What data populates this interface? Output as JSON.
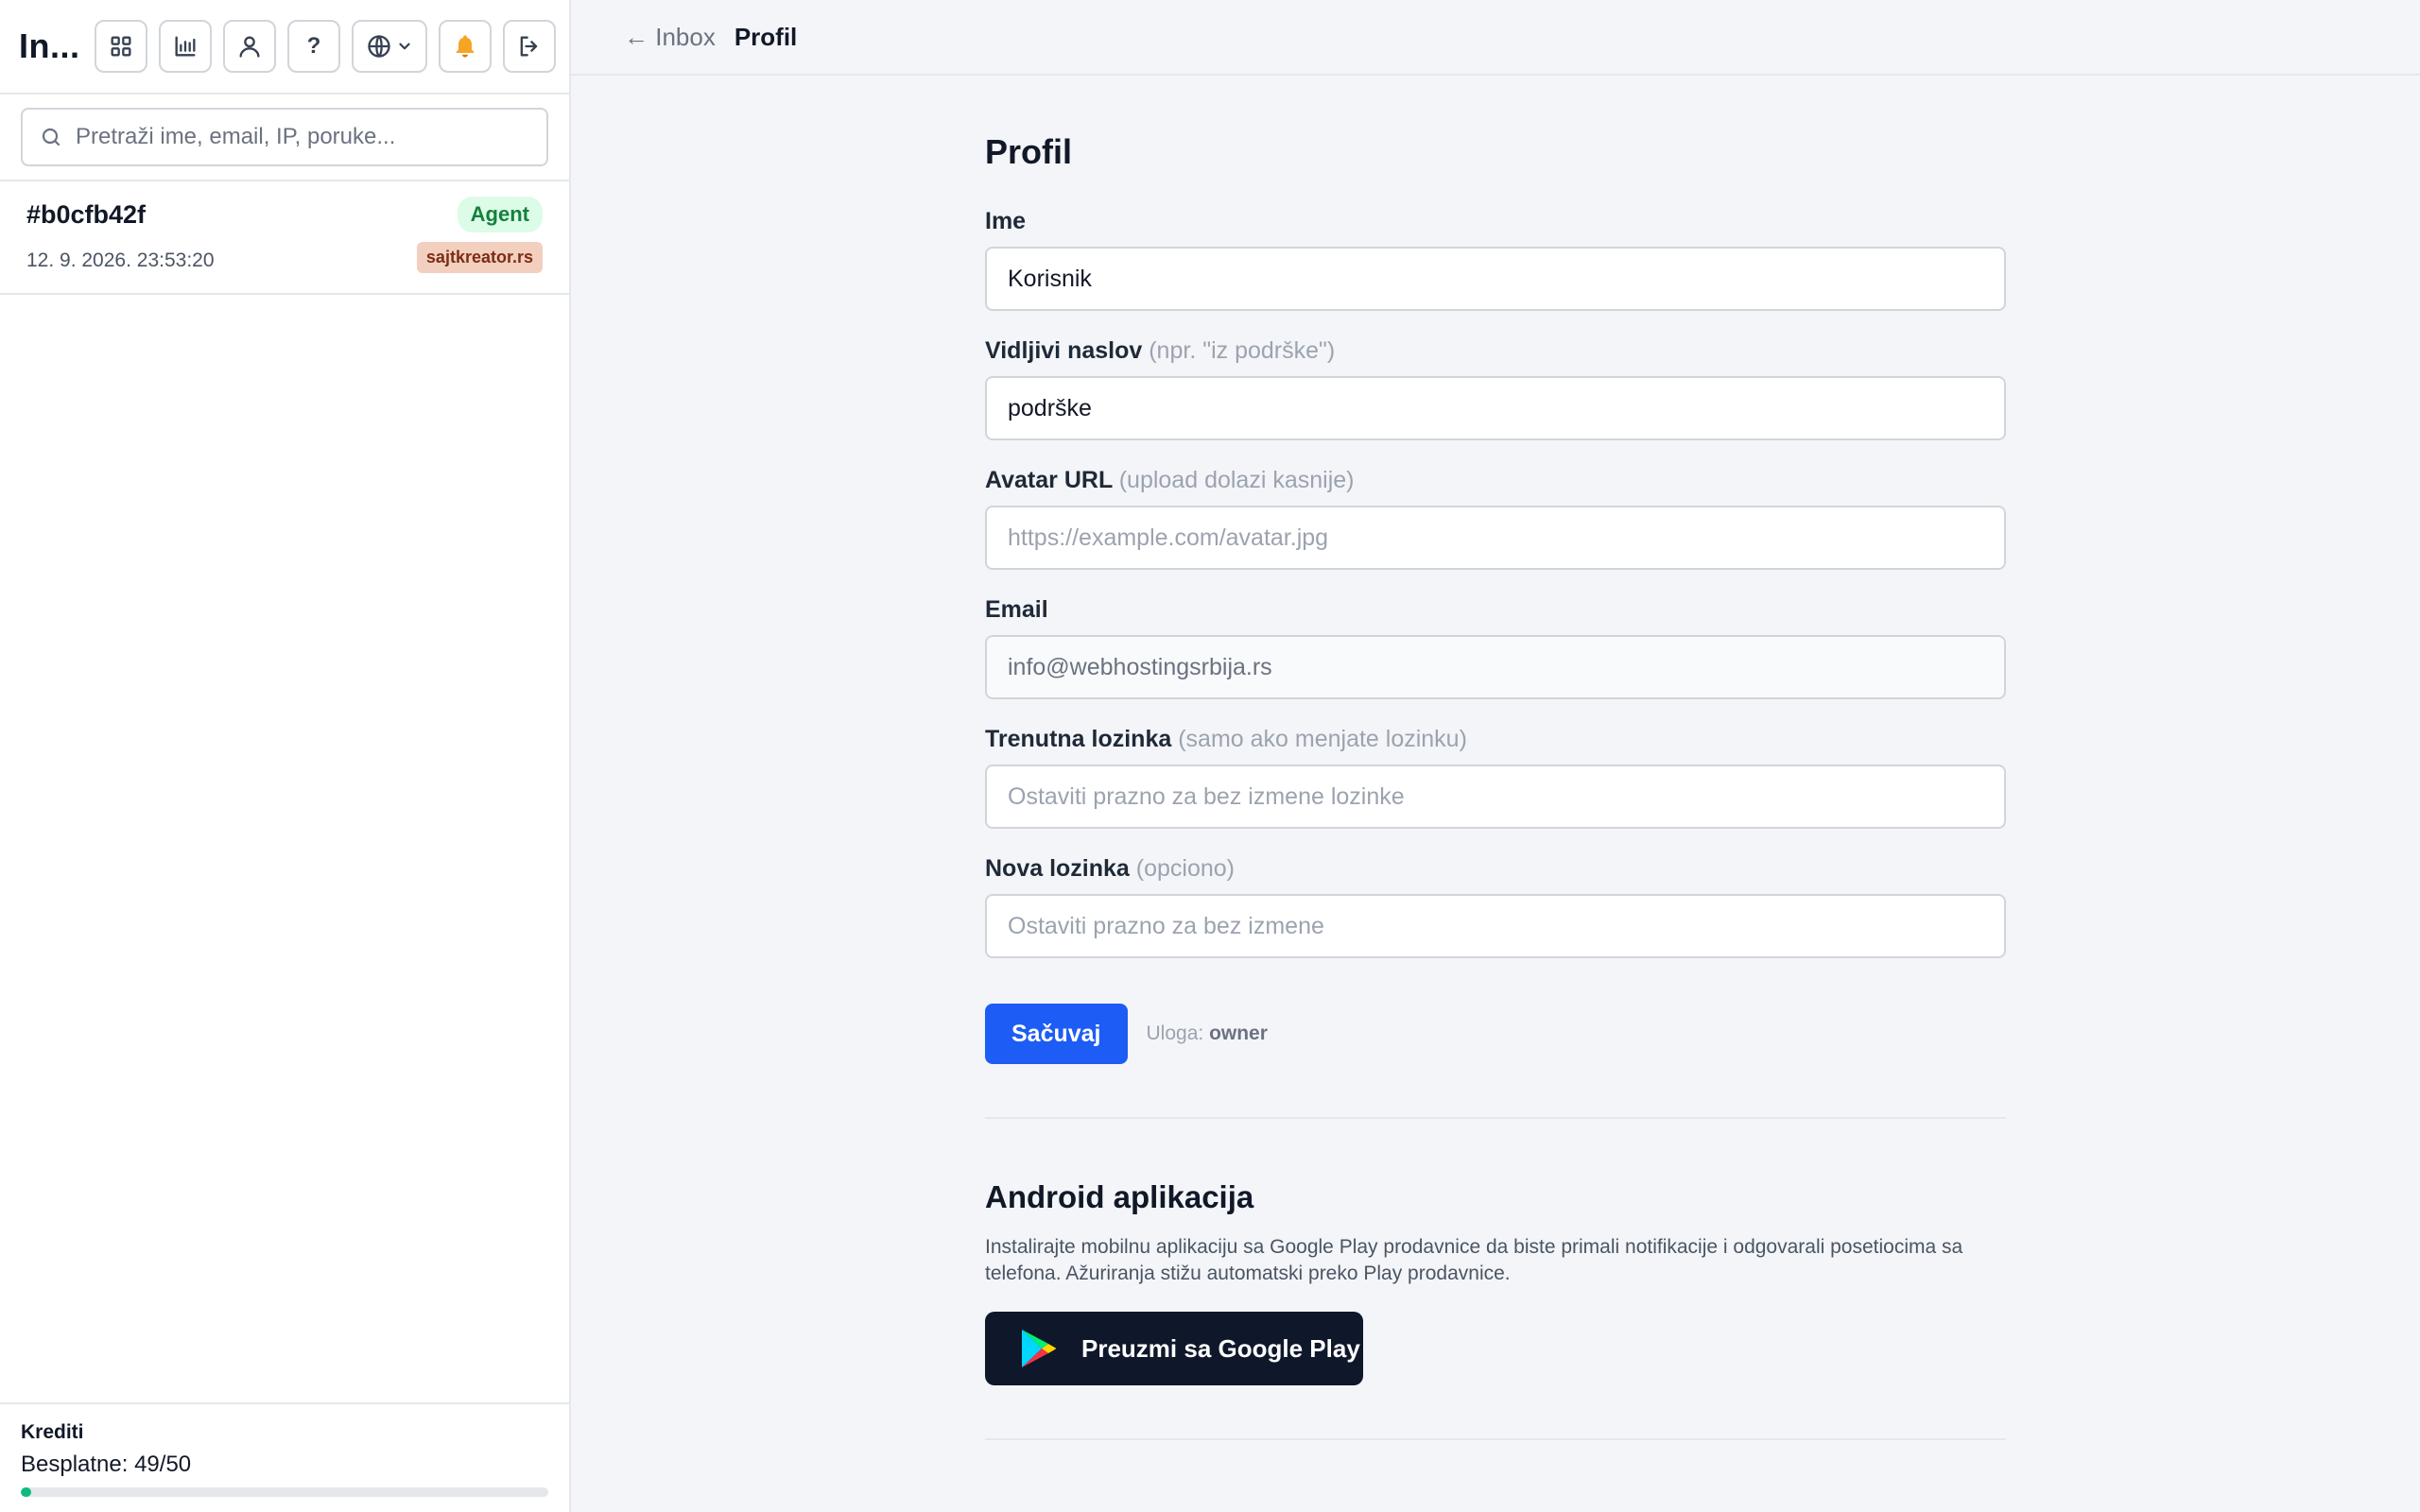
{
  "sidebar": {
    "app_title": "In...",
    "toolbar": {
      "help_label": "?"
    },
    "search": {
      "placeholder": "Pretraži ime, email, IP, poruke..."
    },
    "conversations": [
      {
        "id": "#b0cfb42f",
        "date": "12. 9. 2026. 23:53:20",
        "badge": "Agent",
        "site": "sajtkreator.rs"
      }
    ],
    "credits": {
      "title": "Krediti",
      "value": "Besplatne: 49/50",
      "progress": 0.02
    }
  },
  "topbar": {
    "back_label": "← Inbox",
    "current": "Profil"
  },
  "profile": {
    "title": "Profil",
    "fields": {
      "name": {
        "label": "Ime",
        "hint": "",
        "value": "Korisnik",
        "placeholder": ""
      },
      "visible_title": {
        "label": "Vidljivi naslov",
        "hint": "(npr. \"iz podrške\")",
        "value": "podrške",
        "placeholder": ""
      },
      "avatar": {
        "label": "Avatar URL",
        "hint": "(upload dolazi kasnije)",
        "value": "",
        "placeholder": "https://example.com/avatar.jpg"
      },
      "email": {
        "label": "Email",
        "hint": "",
        "value": "info@webhostingsrbija.rs",
        "placeholder": ""
      },
      "current_password": {
        "label": "Trenutna lozinka",
        "hint": "(samo ako menjate lozinku)",
        "value": "",
        "placeholder": "Ostaviti prazno za bez izmene lozinke"
      },
      "new_password": {
        "label": "Nova lozinka",
        "hint": "(opciono)",
        "value": "",
        "placeholder": "Ostaviti prazno za bez izmene"
      }
    },
    "save_label": "Sačuvaj",
    "role_label": "Uloga:",
    "role_value": "owner"
  },
  "android": {
    "title": "Android aplikacija",
    "description": "Instalirajte mobilnu aplikaciju sa Google Play prodavnice da biste primali notifikacije i odgovarali posetiocima sa telefona. Ažuriranja stižu automatski preko Play prodavnice.",
    "button_label": "Preuzmi sa Google Play"
  },
  "colors": {
    "primary": "#1d5cf5",
    "agent_badge_bg": "#dcfce7",
    "agent_badge_text": "#15803d",
    "site_badge_bg": "#f3cfc0",
    "progress": "#10b981",
    "play_button_bg": "#0f172a"
  }
}
